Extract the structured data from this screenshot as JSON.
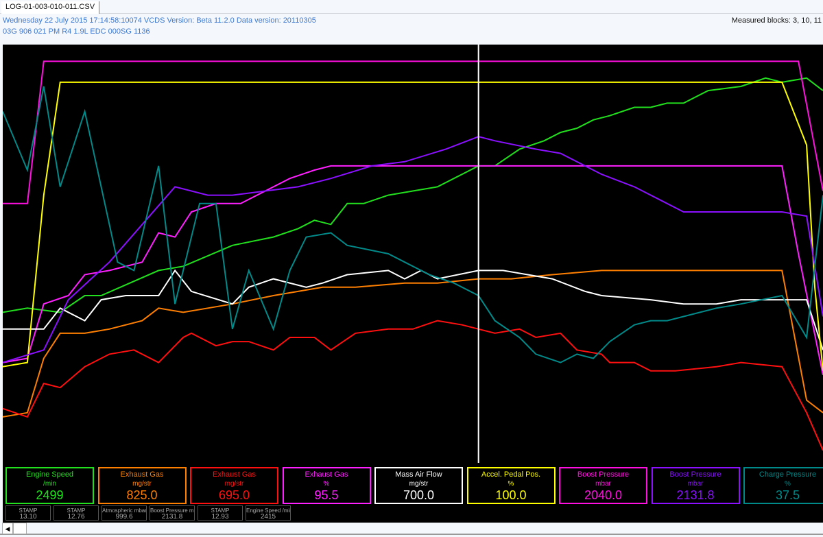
{
  "tab": {
    "label": "LOG-01-003-010-011.CSV"
  },
  "header": {
    "line1": "Wednesday 22 July 2015 17:14:58:10074 VCDS Version: Beta 11.2.0 Data version: 20110305",
    "line2": "03G 906 021 PM  R4 1.9L EDC  000SG  1136",
    "measured_blocks": "Measured blocks: 3, 10, 11"
  },
  "gauges": [
    {
      "label": "Engine Speed",
      "unit": "/min",
      "value": "2499",
      "color": "#22e01e"
    },
    {
      "label": "Exhaust Gas",
      "unit": "mg/str",
      "value": "825.0",
      "color": "#ff8000"
    },
    {
      "label": "Exhaust Gas",
      "unit": "mg/str",
      "value": "695.0",
      "color": "#ff1010"
    },
    {
      "label": "Exhaust Gas",
      "unit": "%",
      "value": "95.5",
      "color": "#ff20ff"
    },
    {
      "label": "Mass Air Flow",
      "unit": "mg/str",
      "value": "700.0",
      "color": "#ffffff"
    },
    {
      "label": "Accel. Pedal Pos.",
      "unit": "%",
      "value": "100.0",
      "color": "#ffff00"
    },
    {
      "label": "Boost Pressure",
      "unit": "mbar",
      "value": "2040.0",
      "color": "#ff10e0"
    },
    {
      "label": "Boost Pressure",
      "unit": "mbar",
      "value": "2131.8",
      "color": "#8a10ff"
    },
    {
      "label": "Charge Pressure",
      "unit": "%",
      "value": "37.5",
      "color": "#008a8a"
    }
  ],
  "mini": [
    {
      "label": "STAMP",
      "value": "13.10"
    },
    {
      "label": "STAMP",
      "value": "12.76"
    },
    {
      "label": "Atmospheric mbar",
      "value": "999.6"
    },
    {
      "label": "Boost Pressure m...",
      "value": "2131.8"
    },
    {
      "label": "STAMP",
      "value": "12.93"
    },
    {
      "label": "Engine Speed /min",
      "value": "2415"
    }
  ],
  "chart_data": {
    "type": "line",
    "title": "",
    "xlabel": "",
    "ylabel": "",
    "xlim": [
      0,
      100
    ],
    "ylim": [
      0,
      100
    ],
    "grid": false,
    "cursor_x": 58,
    "series": [
      {
        "name": "Engine Speed",
        "color": "#22e01e",
        "points": [
          [
            0,
            36
          ],
          [
            3,
            37
          ],
          [
            7,
            36
          ],
          [
            10,
            40
          ],
          [
            12,
            40
          ],
          [
            19,
            46
          ],
          [
            22,
            47
          ],
          [
            28,
            52
          ],
          [
            33,
            54
          ],
          [
            36,
            56
          ],
          [
            38,
            58
          ],
          [
            40,
            57
          ],
          [
            42,
            62
          ],
          [
            44,
            62
          ],
          [
            47,
            64
          ],
          [
            50,
            65
          ],
          [
            53,
            66
          ],
          [
            56,
            69
          ],
          [
            58,
            71
          ],
          [
            60,
            71
          ],
          [
            63,
            75
          ],
          [
            66,
            77
          ],
          [
            68,
            79
          ],
          [
            70,
            80
          ],
          [
            72,
            82
          ],
          [
            74,
            83
          ],
          [
            77,
            85
          ],
          [
            79,
            85
          ],
          [
            81,
            86
          ],
          [
            83,
            86
          ],
          [
            86,
            89
          ],
          [
            90,
            90
          ],
          [
            93,
            92
          ],
          [
            95,
            91
          ],
          [
            98,
            92
          ],
          [
            100,
            89
          ]
        ]
      },
      {
        "name": "Exhaust Gas mg/str (orange)",
        "color": "#ff8000",
        "points": [
          [
            0,
            11
          ],
          [
            3,
            12
          ],
          [
            5,
            25
          ],
          [
            7,
            31
          ],
          [
            10,
            31
          ],
          [
            13,
            32
          ],
          [
            17,
            34
          ],
          [
            19,
            37
          ],
          [
            22,
            36
          ],
          [
            25,
            37
          ],
          [
            28,
            38
          ],
          [
            33,
            40
          ],
          [
            39,
            42
          ],
          [
            43,
            42
          ],
          [
            49,
            43
          ],
          [
            53,
            43
          ],
          [
            58,
            44
          ],
          [
            62,
            44
          ],
          [
            67,
            45
          ],
          [
            73,
            46
          ],
          [
            95,
            46
          ],
          [
            98,
            15
          ],
          [
            100,
            12
          ]
        ]
      },
      {
        "name": "Exhaust Gas mg/str (red)",
        "color": "#ff1010",
        "points": [
          [
            0,
            13
          ],
          [
            3,
            11
          ],
          [
            5,
            19
          ],
          [
            7,
            18
          ],
          [
            10,
            23
          ],
          [
            13,
            26
          ],
          [
            16,
            27
          ],
          [
            19,
            24
          ],
          [
            22,
            30
          ],
          [
            23,
            31
          ],
          [
            26,
            28
          ],
          [
            28,
            29
          ],
          [
            30,
            29
          ],
          [
            33,
            27
          ],
          [
            35,
            30
          ],
          [
            38,
            30
          ],
          [
            40,
            27
          ],
          [
            43,
            31
          ],
          [
            47,
            32
          ],
          [
            50,
            32
          ],
          [
            53,
            34
          ],
          [
            56,
            33
          ],
          [
            58,
            32
          ],
          [
            60,
            31
          ],
          [
            63,
            32
          ],
          [
            65,
            30
          ],
          [
            68,
            31
          ],
          [
            70,
            27
          ],
          [
            73,
            26
          ],
          [
            74,
            24
          ],
          [
            77,
            24
          ],
          [
            79,
            22
          ],
          [
            82,
            22
          ],
          [
            87,
            23
          ],
          [
            90,
            24
          ],
          [
            95,
            23
          ],
          [
            98,
            12
          ],
          [
            100,
            3
          ]
        ]
      },
      {
        "name": "Exhaust Gas %",
        "color": "#ff20ff",
        "points": [
          [
            0,
            24
          ],
          [
            3,
            25
          ],
          [
            5,
            38
          ],
          [
            8,
            40
          ],
          [
            10,
            45
          ],
          [
            13,
            46
          ],
          [
            17,
            48
          ],
          [
            19,
            55
          ],
          [
            21,
            54
          ],
          [
            23,
            60
          ],
          [
            26,
            62
          ],
          [
            29,
            62
          ],
          [
            32,
            65
          ],
          [
            35,
            68
          ],
          [
            38,
            70
          ],
          [
            40,
            71
          ],
          [
            95,
            71
          ],
          [
            97,
            50
          ],
          [
            100,
            21
          ]
        ]
      },
      {
        "name": "Mass Air Flow",
        "color": "#ffffff",
        "points": [
          [
            0,
            32
          ],
          [
            5,
            32
          ],
          [
            7,
            37
          ],
          [
            10,
            34
          ],
          [
            12,
            39
          ],
          [
            15,
            40
          ],
          [
            19,
            40
          ],
          [
            21,
            46
          ],
          [
            23,
            41
          ],
          [
            28,
            38
          ],
          [
            30,
            42
          ],
          [
            33,
            44
          ],
          [
            37,
            42
          ],
          [
            39,
            43
          ],
          [
            42,
            45
          ],
          [
            47,
            46
          ],
          [
            49,
            44
          ],
          [
            51,
            46
          ],
          [
            53,
            44
          ],
          [
            58,
            46
          ],
          [
            61,
            46
          ],
          [
            64,
            45
          ],
          [
            67,
            44
          ],
          [
            71,
            41
          ],
          [
            73,
            40
          ],
          [
            79,
            39
          ],
          [
            83,
            38
          ],
          [
            87,
            38
          ],
          [
            90,
            39
          ],
          [
            94,
            39
          ],
          [
            98,
            39
          ],
          [
            100,
            27
          ]
        ]
      },
      {
        "name": "Accel. Pedal Pos.",
        "color": "#ffff00",
        "points": [
          [
            0,
            23
          ],
          [
            3,
            24
          ],
          [
            5,
            64
          ],
          [
            7,
            91
          ],
          [
            95,
            91
          ],
          [
            98,
            76
          ],
          [
            99,
            42
          ],
          [
            100,
            22
          ]
        ]
      },
      {
        "name": "Boost Pressure (magenta)",
        "color": "#ff10e0",
        "points": [
          [
            0,
            62
          ],
          [
            3,
            62
          ],
          [
            5,
            96
          ],
          [
            97,
            96
          ],
          [
            100,
            65
          ]
        ]
      },
      {
        "name": "Boost Pressure (purple)",
        "color": "#8a10ff",
        "points": [
          [
            0,
            24
          ],
          [
            5,
            27
          ],
          [
            8,
            39
          ],
          [
            13,
            48
          ],
          [
            17,
            57
          ],
          [
            21,
            66
          ],
          [
            25,
            64
          ],
          [
            28,
            64
          ],
          [
            32,
            65
          ],
          [
            36,
            66
          ],
          [
            40,
            68
          ],
          [
            45,
            71
          ],
          [
            49,
            72
          ],
          [
            54,
            75
          ],
          [
            58,
            78
          ],
          [
            60,
            77
          ],
          [
            65,
            75
          ],
          [
            68,
            74
          ],
          [
            73,
            69
          ],
          [
            77,
            66
          ],
          [
            80,
            63
          ],
          [
            83,
            60
          ],
          [
            95,
            60
          ],
          [
            98,
            59
          ],
          [
            100,
            35
          ]
        ]
      },
      {
        "name": "Charge Pressure",
        "color": "#008a8a",
        "points": [
          [
            0,
            84
          ],
          [
            3,
            70
          ],
          [
            5,
            90
          ],
          [
            7,
            66
          ],
          [
            10,
            84
          ],
          [
            14,
            48
          ],
          [
            16,
            46
          ],
          [
            19,
            71
          ],
          [
            21,
            38
          ],
          [
            24,
            62
          ],
          [
            26,
            62
          ],
          [
            28,
            32
          ],
          [
            30,
            46
          ],
          [
            33,
            32
          ],
          [
            35,
            46
          ],
          [
            37,
            54
          ],
          [
            40,
            55
          ],
          [
            42,
            52
          ],
          [
            47,
            50
          ],
          [
            49,
            48
          ],
          [
            52,
            45
          ],
          [
            55,
            43
          ],
          [
            58,
            40
          ],
          [
            60,
            34
          ],
          [
            63,
            30
          ],
          [
            65,
            26
          ],
          [
            68,
            24
          ],
          [
            70,
            26
          ],
          [
            72,
            25
          ],
          [
            74,
            29
          ],
          [
            77,
            33
          ],
          [
            79,
            34
          ],
          [
            81,
            34
          ],
          [
            83,
            35
          ],
          [
            87,
            37
          ],
          [
            90,
            38
          ],
          [
            95,
            40
          ],
          [
            98,
            30
          ],
          [
            100,
            64
          ]
        ]
      }
    ]
  }
}
